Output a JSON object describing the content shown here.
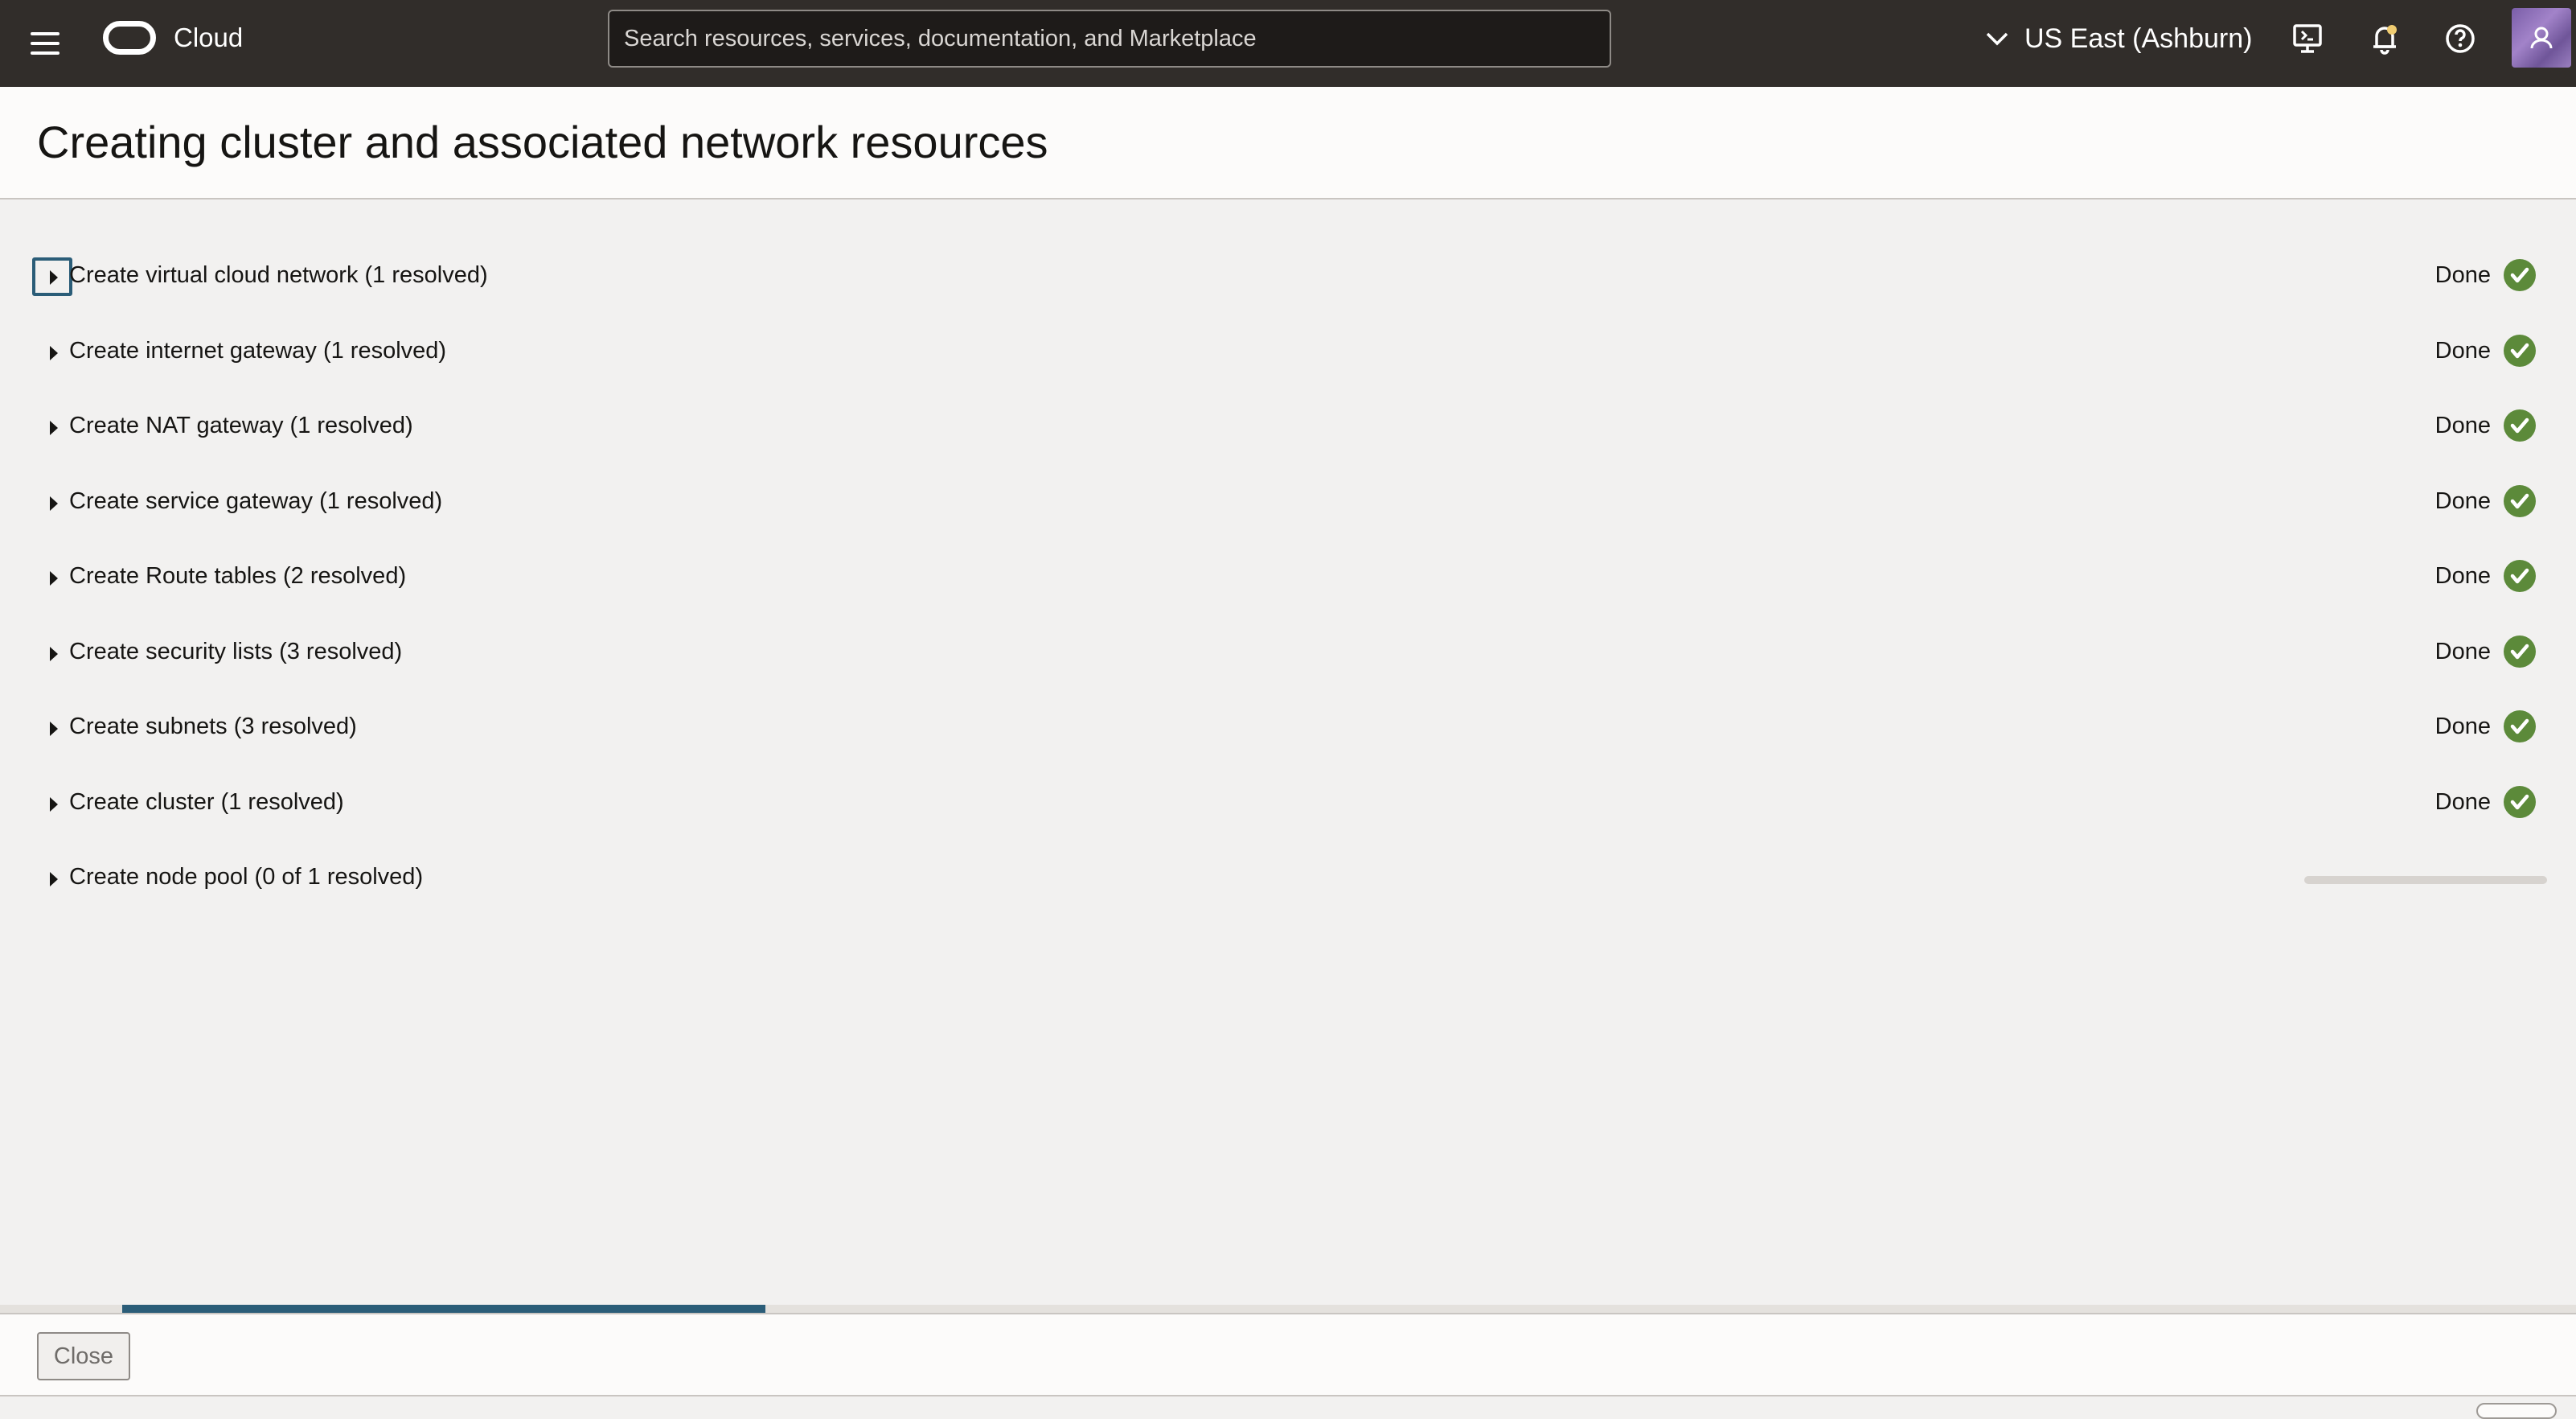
{
  "topbar": {
    "brand": "Cloud",
    "search_placeholder": "Search resources, services, documentation, and Marketplace",
    "region": "US East (Ashburn)",
    "icons": [
      "menu-icon",
      "oracle-logo",
      "chevron-down-icon",
      "cloud-shell-icon",
      "bell-icon",
      "help-icon",
      "avatar"
    ],
    "colors": {
      "bar": "#312d2a",
      "notification_dot": "#f0cc71"
    }
  },
  "page": {
    "title": "Creating cluster and associated network resources"
  },
  "steps": [
    {
      "label": "Create virtual cloud network (1 resolved)",
      "status": "Done"
    },
    {
      "label": "Create internet gateway (1 resolved)",
      "status": "Done"
    },
    {
      "label": "Create NAT gateway (1 resolved)",
      "status": "Done"
    },
    {
      "label": "Create service gateway (1 resolved)",
      "status": "Done"
    },
    {
      "label": "Create Route tables (2 resolved)",
      "status": "Done"
    },
    {
      "label": "Create security lists (3 resolved)",
      "status": "Done"
    },
    {
      "label": "Create subnets (3 resolved)",
      "status": "Done"
    },
    {
      "label": "Create cluster (1 resolved)",
      "status": "Done"
    },
    {
      "label": "Create node pool (0 of 1 resolved)",
      "status": ""
    }
  ],
  "colors": {
    "success": "#5c8a3a",
    "progress": "#2b5d78"
  },
  "footer": {
    "close_label": "Close"
  }
}
